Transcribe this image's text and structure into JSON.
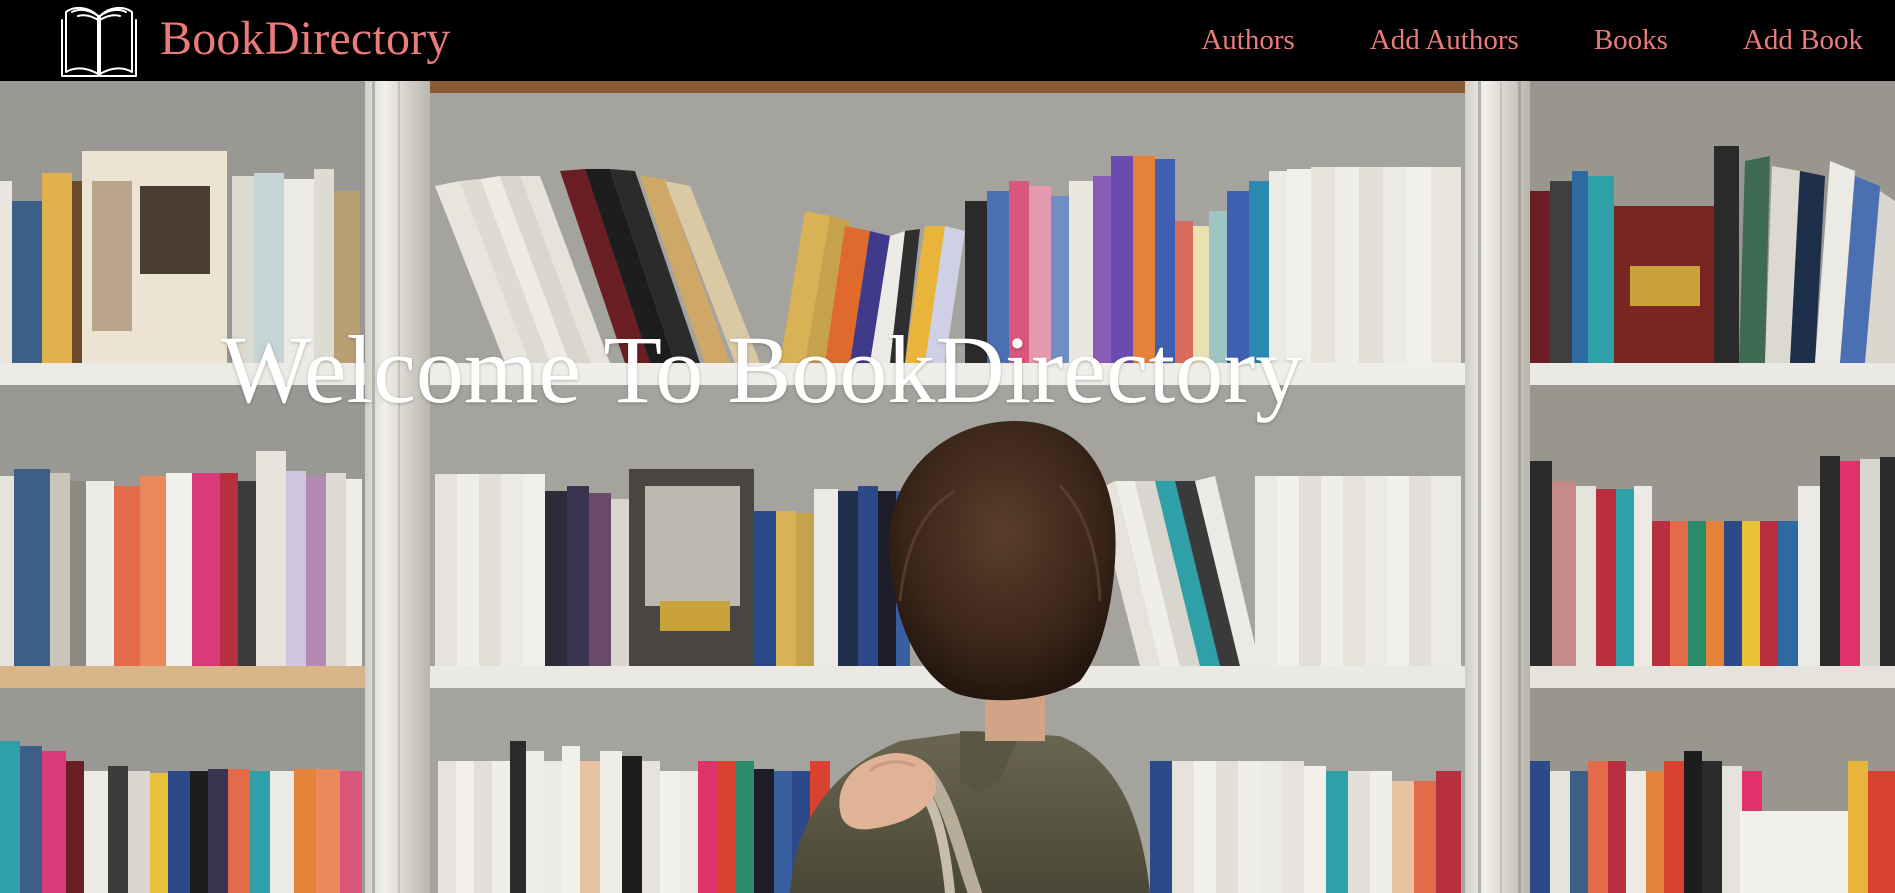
{
  "brand": {
    "name": "BookDirectory",
    "icon": "open-book-icon",
    "color": "#e97b7b"
  },
  "nav": {
    "items": [
      {
        "label": "Authors"
      },
      {
        "label": "Add Authors"
      },
      {
        "label": "Books"
      },
      {
        "label": "Add Book"
      }
    ],
    "link_color": "#e97b7b",
    "background": "#000000"
  },
  "hero": {
    "title": "Welcome To BookDirectory",
    "title_color": "#ffffff",
    "background_image": "bookshelf-woman-photo"
  }
}
